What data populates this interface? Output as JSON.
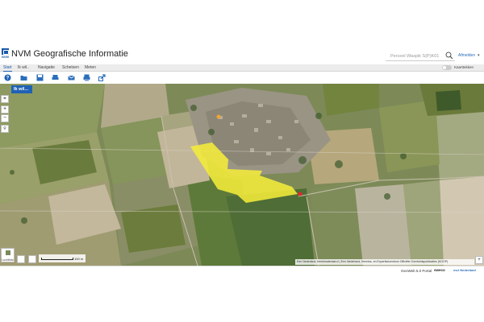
{
  "app": {
    "title": "NVM Geografische Informatie",
    "logo_text": "NVM"
  },
  "search": {
    "placeholder": "Perceel Waspik S(P)K01"
  },
  "account": {
    "signin_label": "Afmelden"
  },
  "tabs": [
    {
      "label": "Start",
      "active": true
    },
    {
      "label": "Ik wil..",
      "active": false
    },
    {
      "label": "Navigatie",
      "active": false
    },
    {
      "label": "Schetsen",
      "active": false
    },
    {
      "label": "Meten",
      "active": false
    }
  ],
  "toggle": {
    "label": "Kaarttekken"
  },
  "toolbar": {
    "icons": [
      "help-icon",
      "open-folder-icon",
      "save-icon",
      "print-icon",
      "email-icon",
      "print2-icon",
      "share-icon"
    ]
  },
  "map": {
    "iwil_label": "Ik wil...",
    "basemap_label": "Luchtfoto",
    "scale_label": "100 m",
    "attribution": "Een Nederland, beeldmateriaal.nl | Een Nederland, Kenniss- en Expertisecentrum Officiële Overheidspublicaties (KOOP)",
    "highlight_color": "#f4ec3a",
    "marker_color": "#e8262a"
  },
  "footer": {
    "portal": "GeoWeb 5.0 Portal",
    "brand1": "sweco",
    "brand2": "esri Nederland"
  },
  "colors": {
    "accent": "#1a5aa8",
    "header_bg": "#ffffff",
    "tabbar_bg": "#ececec"
  }
}
